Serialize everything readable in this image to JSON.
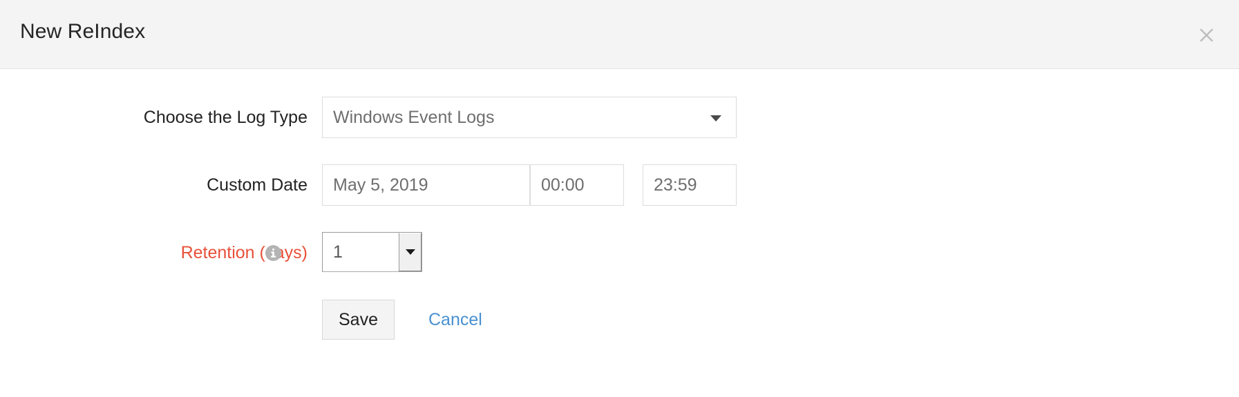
{
  "dialog": {
    "title": "New ReIndex",
    "close_icon": "close-icon"
  },
  "form": {
    "log_type": {
      "label": "Choose the Log Type",
      "value": "Windows Event Logs",
      "caret_icon": "chevron-down-icon"
    },
    "custom_date": {
      "label": "Custom Date",
      "date_value": "May 5, 2019",
      "time_from_value": "00:00",
      "time_to_value": "23:59"
    },
    "retention": {
      "label": "Retention (days)",
      "value": "1",
      "info_icon": "info-icon",
      "arrow_icon": "chevron-down-icon"
    }
  },
  "actions": {
    "save_label": "Save",
    "cancel_label": "Cancel"
  },
  "colors": {
    "header_background": "#f4f4f4",
    "required_label": "#e8503a",
    "link": "#4a90d0",
    "info_icon_background": "#b4b4b4",
    "border": "#dcdcdc"
  }
}
